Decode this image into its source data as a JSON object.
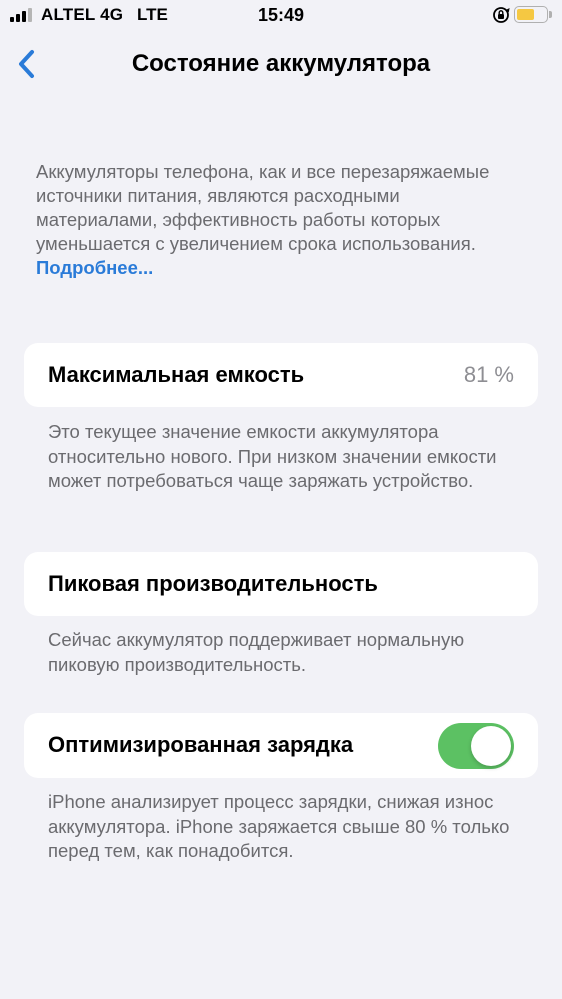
{
  "status_bar": {
    "carrier": "ALTEL 4G",
    "network": "LTE",
    "time": "15:49",
    "signal_bars": 4,
    "signal_bars_active": 3,
    "battery_color": "#f5c842"
  },
  "nav": {
    "back_icon": "chevron-left-icon",
    "title": "Состояние аккумулятора",
    "accent_color": "#2a7bd8"
  },
  "intro": {
    "text": "Аккумуляторы телефона, как и все перезаряжаемые источники питания, являются расходными материалами, эффективность работы которых уменьшается с увеличением срока использования. ",
    "link": "Подробнее..."
  },
  "max_capacity": {
    "label": "Максимальная емкость",
    "value": "81 %",
    "footnote": "Это текущее значение емкости аккумулятора относительно нового. При низком значении емкости может потребоваться чаще заряжать устройство."
  },
  "peak_performance": {
    "label": "Пиковая производительность",
    "footnote": "Сейчас аккумулятор поддерживает нормальную пиковую производительность."
  },
  "optimized_charging": {
    "label": "Оптимизированная зарядка",
    "enabled": true,
    "toggle_color": "#5cc163",
    "footnote": "iPhone анализирует процесс зарядки, снижая износ аккумулятора. iPhone заряжается свыше 80 % только перед тем, как понадобится."
  }
}
